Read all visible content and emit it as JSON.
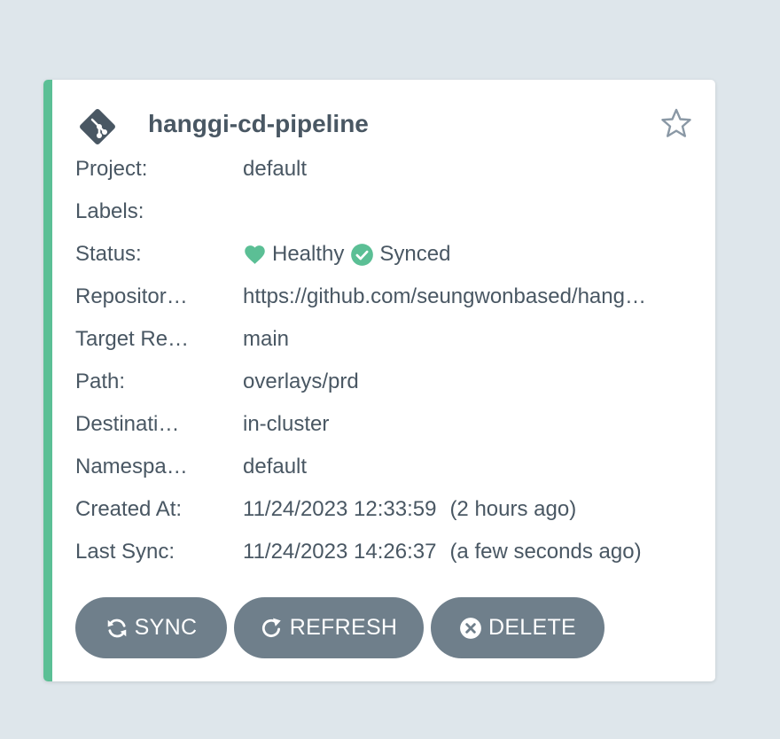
{
  "app": {
    "name": "hanggi-cd-pipeline",
    "icon": "git-branch-icon",
    "favorite_icon": "star-outline-icon"
  },
  "details": {
    "project": {
      "label": "Project:",
      "value": "default"
    },
    "labels": {
      "label": "Labels:",
      "value": ""
    },
    "status": {
      "label": "Status:",
      "health": "Healthy",
      "health_icon": "heart-icon",
      "sync": "Synced",
      "sync_icon": "check-circle-icon"
    },
    "repository": {
      "label": "Repositor…",
      "value": "https://github.com/seungwonbased/hang…"
    },
    "target_revision": {
      "label": "Target Re…",
      "value": "main"
    },
    "path": {
      "label": "Path:",
      "value": "overlays/prd"
    },
    "destination": {
      "label": "Destinati…",
      "value": "in-cluster"
    },
    "namespace": {
      "label": "Namespa…",
      "value": "default"
    },
    "created_at": {
      "label": "Created At:",
      "value": "11/24/2023 12:33:59",
      "ago": "(2 hours ago)"
    },
    "last_sync": {
      "label": "Last Sync:",
      "value": "11/24/2023 14:26:37",
      "ago": "(a few seconds ago)"
    }
  },
  "actions": {
    "sync": {
      "label": "SYNC",
      "icon": "sync-icon"
    },
    "refresh": {
      "label": "REFRESH",
      "icon": "refresh-icon"
    },
    "delete": {
      "label": "DELETE",
      "icon": "close-circle-icon"
    }
  },
  "colors": {
    "background": "#dee6eb",
    "card": "#ffffff",
    "accent": "#5bbf95",
    "text": "#495763",
    "button": "#6f7f8b",
    "healthy": "#5bbf95",
    "synced": "#5bbf95"
  }
}
